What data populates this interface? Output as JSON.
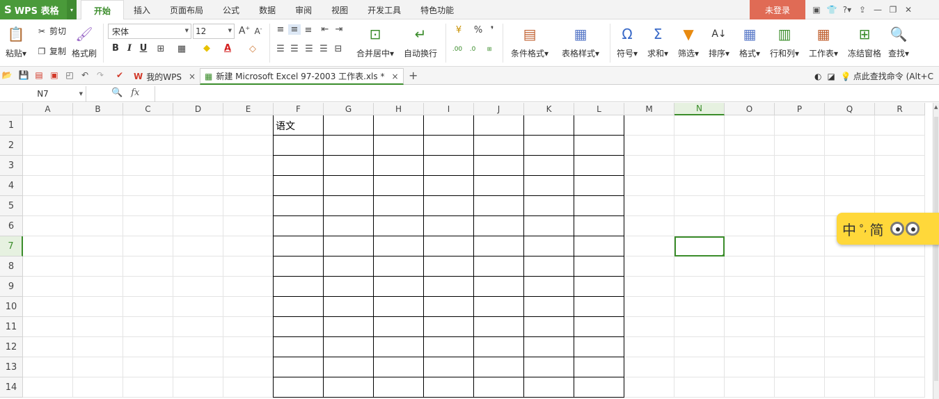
{
  "app": {
    "logo_glyph": "S",
    "title": "WPS 表格",
    "dropdown_glyph": "▾"
  },
  "menu": {
    "tabs": [
      "开始",
      "插入",
      "页面布局",
      "公式",
      "数据",
      "审阅",
      "视图",
      "开发工具",
      "特色功能"
    ],
    "active_tab": "开始",
    "login": "未登录",
    "window_glyphs": [
      "▣",
      "👕",
      "?▾",
      "⇪",
      "—",
      "❐",
      "✕"
    ]
  },
  "ribbon": {
    "paste": "粘贴▾",
    "cut": "剪切",
    "copy": "复制",
    "format_painter": "格式刷",
    "font_name": "宋体",
    "font_size": "12",
    "bold": "B",
    "italic": "I",
    "underline": "U",
    "merge_center": "合并居中▾",
    "wrap_text": "自动换行",
    "percent": "%",
    "thousands": "❜",
    "conditional_format": "条件格式▾",
    "table_style": "表格样式▾",
    "symbol": "符号▾",
    "sum": "求和▾",
    "filter": "筛选▾",
    "sort": "排序▾",
    "format": "格式▾",
    "rows_cols": "行和列▾",
    "worksheet": "工作表▾",
    "freeze": "冻结窗格",
    "find": "查找▾"
  },
  "tabs": {
    "home_tab": "我的WPS",
    "file_tab": "新建 Microsoft Excel 97-2003 工作表.xls *",
    "close_glyph": "×",
    "add_glyph": "+",
    "command_search": "点此查找命令 (Alt+C"
  },
  "formula_bar": {
    "name_box": "N7",
    "fx": "fx",
    "formula": ""
  },
  "sheet": {
    "columns": [
      "A",
      "B",
      "C",
      "D",
      "E",
      "F",
      "G",
      "H",
      "I",
      "J",
      "K",
      "L",
      "M",
      "N",
      "O",
      "P",
      "Q",
      "R"
    ],
    "rows": [
      "1",
      "2",
      "3",
      "4",
      "5",
      "6",
      "7",
      "8",
      "9",
      "10",
      "11",
      "12",
      "13",
      "14"
    ],
    "selected_cell": "N7",
    "cell_F1": "语文"
  },
  "ime": {
    "mode": "中",
    "punct": "°,",
    "script": "简"
  },
  "colors": {
    "accent": "#3a8c2a",
    "brand": "#4a9a3a",
    "login": "#e06b55",
    "ime": "#ffd83a"
  }
}
